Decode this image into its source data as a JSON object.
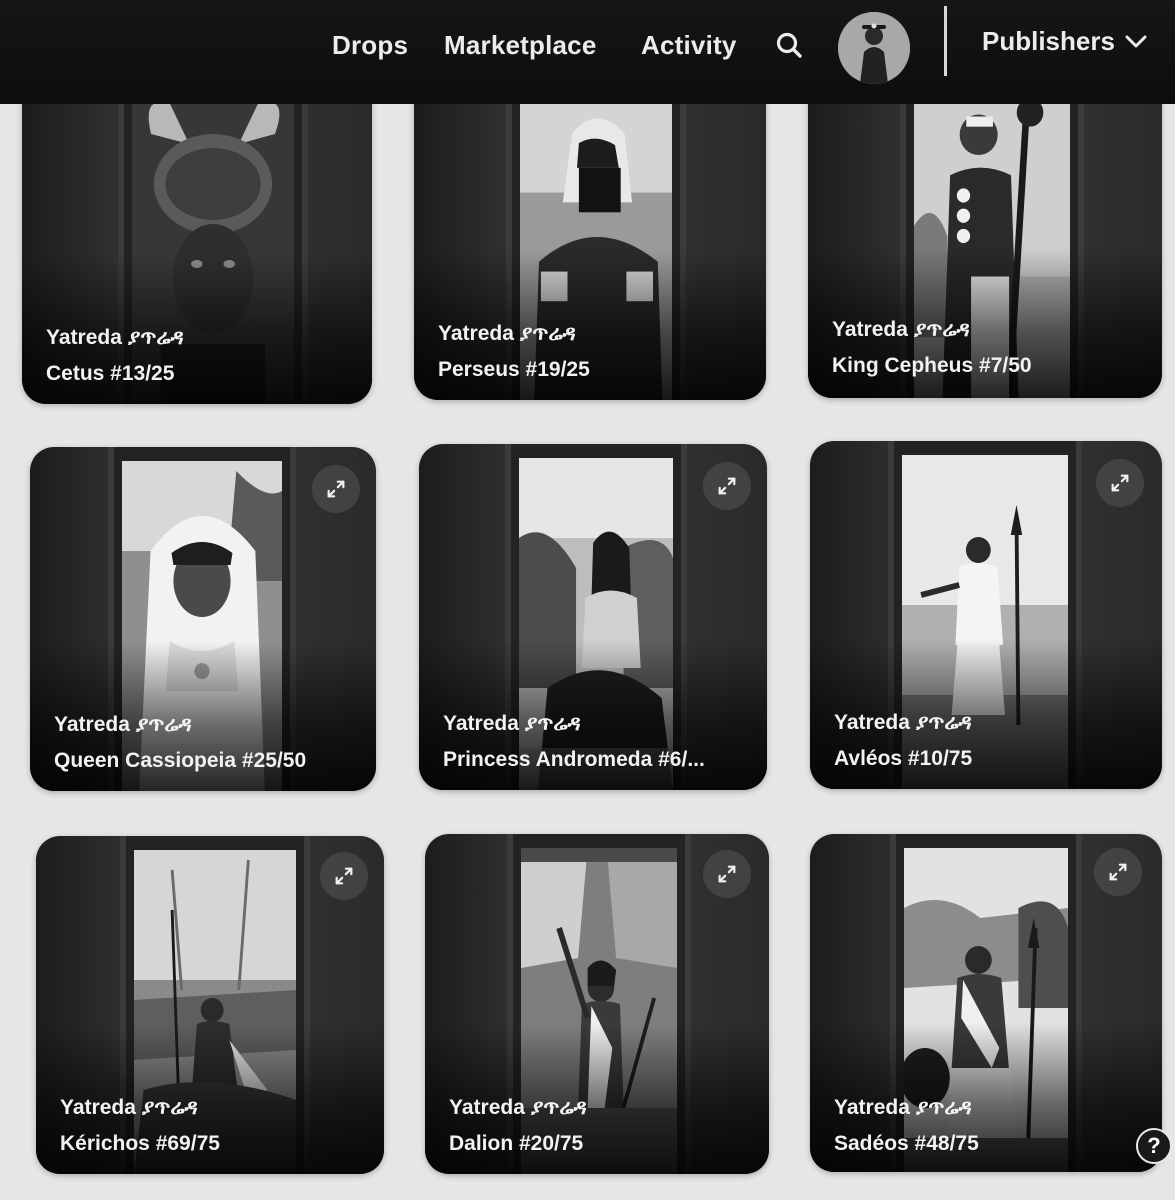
{
  "nav": {
    "drops": "Drops",
    "marketplace": "Marketplace",
    "activity": "Activity",
    "publishers": "Publishers",
    "search_icon": "search-icon",
    "chevron_icon": "chevron-down-icon"
  },
  "cards": [
    {
      "creator": "Yatreda ያጥሬዳ",
      "title": "Cetus #13/25"
    },
    {
      "creator": "Yatreda ያጥሬዳ",
      "title": "Perseus #19/25"
    },
    {
      "creator": "Yatreda ያጥሬዳ",
      "title": "King Cepheus #7/50"
    },
    {
      "creator": "Yatreda ያጥሬዳ",
      "title": "Queen Cassiopeia #25/50"
    },
    {
      "creator": "Yatreda ያጥሬዳ",
      "title": "Princess Andromeda #6/..."
    },
    {
      "creator": "Yatreda ያጥሬዳ",
      "title": "Avléos #10/75"
    },
    {
      "creator": "Yatreda ያጥሬዳ",
      "title": "Kérichos #69/75"
    },
    {
      "creator": "Yatreda ያጥሬዳ",
      "title": "Dalion #20/75"
    },
    {
      "creator": "Yatreda ያጥሬዳ",
      "title": "Sadéos #48/75"
    }
  ],
  "help": "?"
}
